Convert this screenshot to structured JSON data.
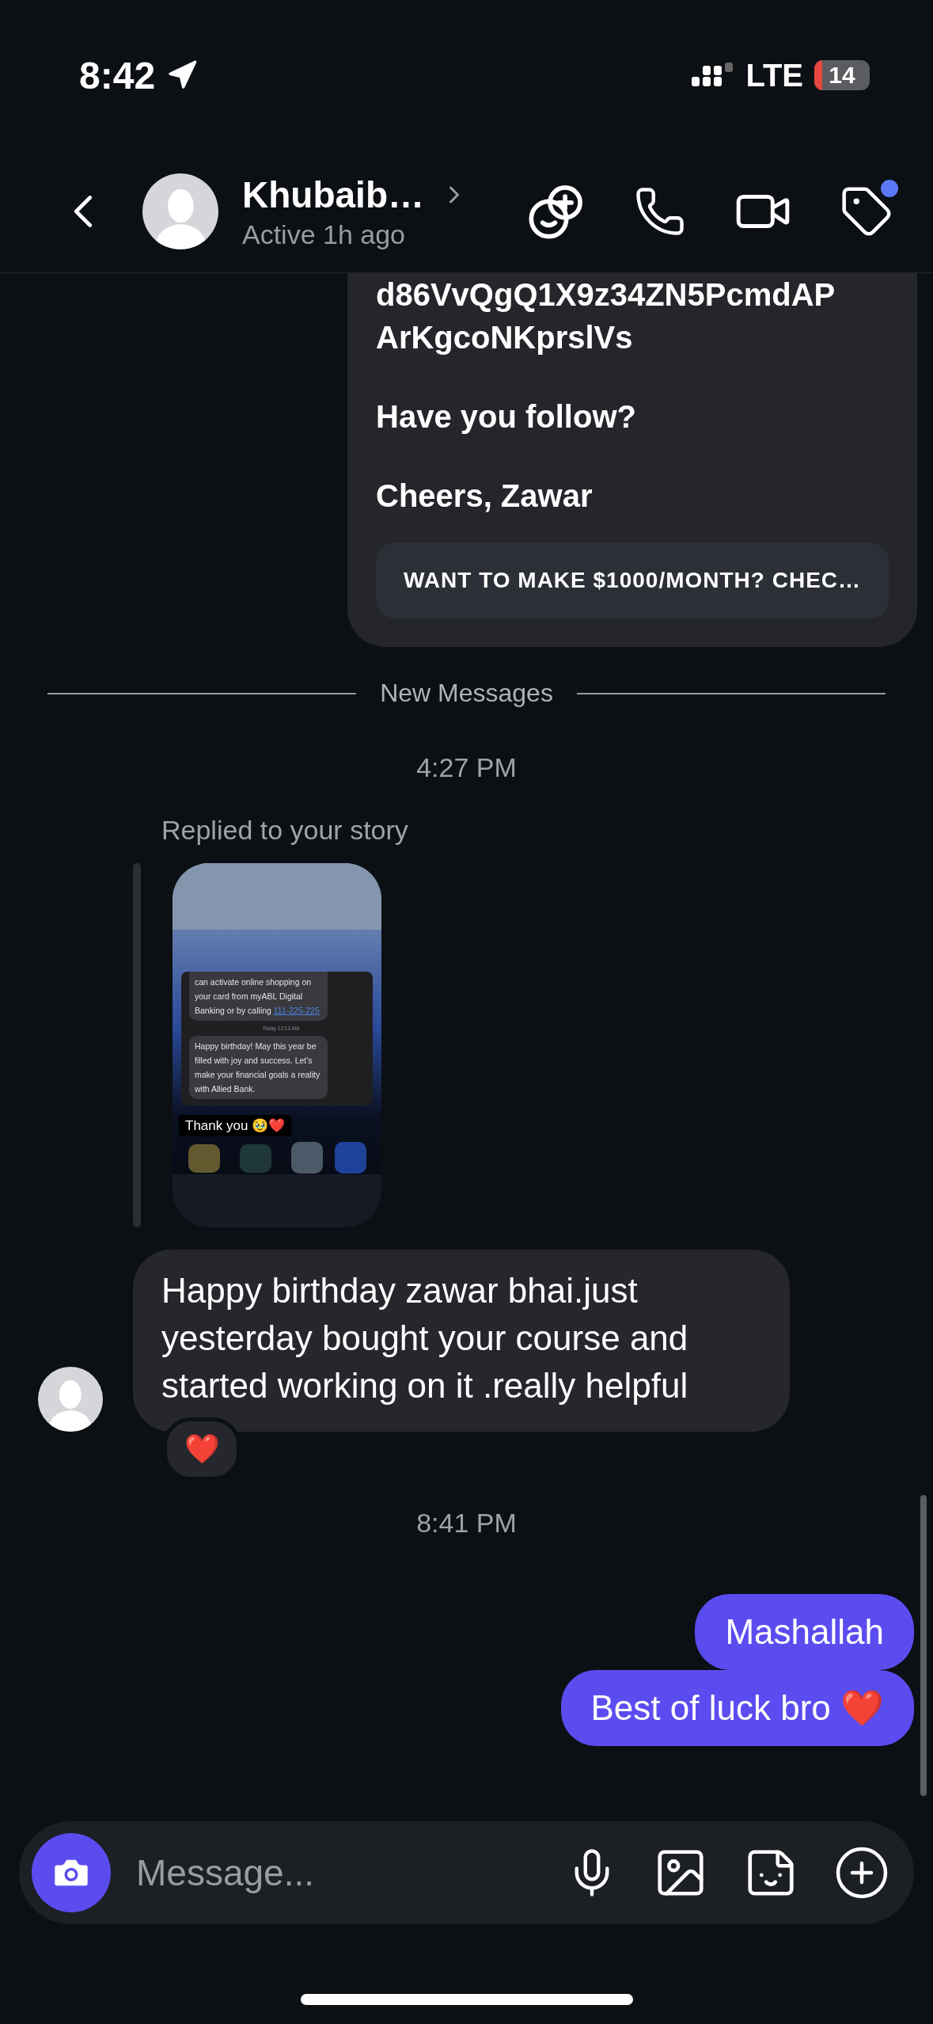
{
  "status_bar": {
    "time": "8:42",
    "network": "LTE",
    "battery": "14"
  },
  "header": {
    "name": "Khubaib…",
    "presence": "Active 1h ago",
    "notification_dot": true
  },
  "messages": [
    {
      "kind": "outgoing_card",
      "lines": [
        "d86VvQgQ1X9z34ZN5PcmdAP",
        "ArKgcoNKprslVs",
        "Have you follow?",
        "Cheers, Zawar"
      ],
      "link": "WANT TO MAKE $1000/MONTH? CHEC…"
    },
    {
      "kind": "divider",
      "text": "New Messages"
    },
    {
      "kind": "time",
      "text": "4:27 PM"
    },
    {
      "kind": "story_reply",
      "text": "Replied to your story",
      "story": {
        "bubble_1": "can activate online shopping on your card from myABL Digital Banking or by calling ",
        "link": "111-225-225",
        "timestamp": "Today 12:13 AM",
        "bubble_2": "Happy birthday! May this year be filled with joy and success. Let's make your financial goals a reality with Allied Bank.",
        "caption": "Thank you 🥹❤️"
      }
    },
    {
      "kind": "incoming",
      "text": "Happy birthday zawar bhai.just yesterday bought your course and started working on it .really helpful",
      "reaction": "❤️"
    },
    {
      "kind": "time",
      "text": "8:41 PM"
    },
    {
      "kind": "outgoing",
      "text": "Mashallah"
    },
    {
      "kind": "outgoing",
      "text": "Best of luck bro ❤️"
    }
  ],
  "composer": {
    "placeholder": "Message..."
  }
}
